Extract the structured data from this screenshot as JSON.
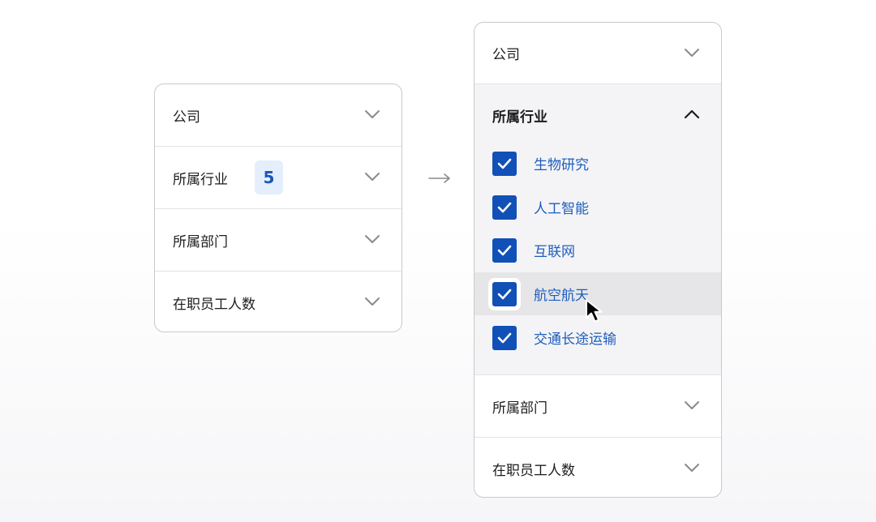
{
  "left_panel": {
    "rows": [
      {
        "label": "公司"
      },
      {
        "label": "所属行业",
        "badge": "5"
      },
      {
        "label": "所属部门"
      },
      {
        "label": "在职员工人数"
      }
    ]
  },
  "right_panel": {
    "company": {
      "label": "公司"
    },
    "industry": {
      "label": "所属行业",
      "options": [
        {
          "label": "生物研究",
          "checked": true
        },
        {
          "label": "人工智能",
          "checked": true
        },
        {
          "label": "互联网",
          "checked": true
        },
        {
          "label": "航空航天",
          "checked": true
        },
        {
          "label": "交通长途运输",
          "checked": true
        }
      ]
    },
    "department": {
      "label": "所属部门"
    },
    "staff": {
      "label": "在职员工人数"
    }
  },
  "colors": {
    "accent": "#1150b7",
    "option_text": "#1e5dbd",
    "badge_bg": "#e4eefc",
    "border": "#c9c9cd"
  },
  "icons": [
    "chevron-down-icon",
    "chevron-up-icon",
    "checkmark-icon",
    "arrow-right-icon",
    "mouse-pointer-icon"
  ]
}
